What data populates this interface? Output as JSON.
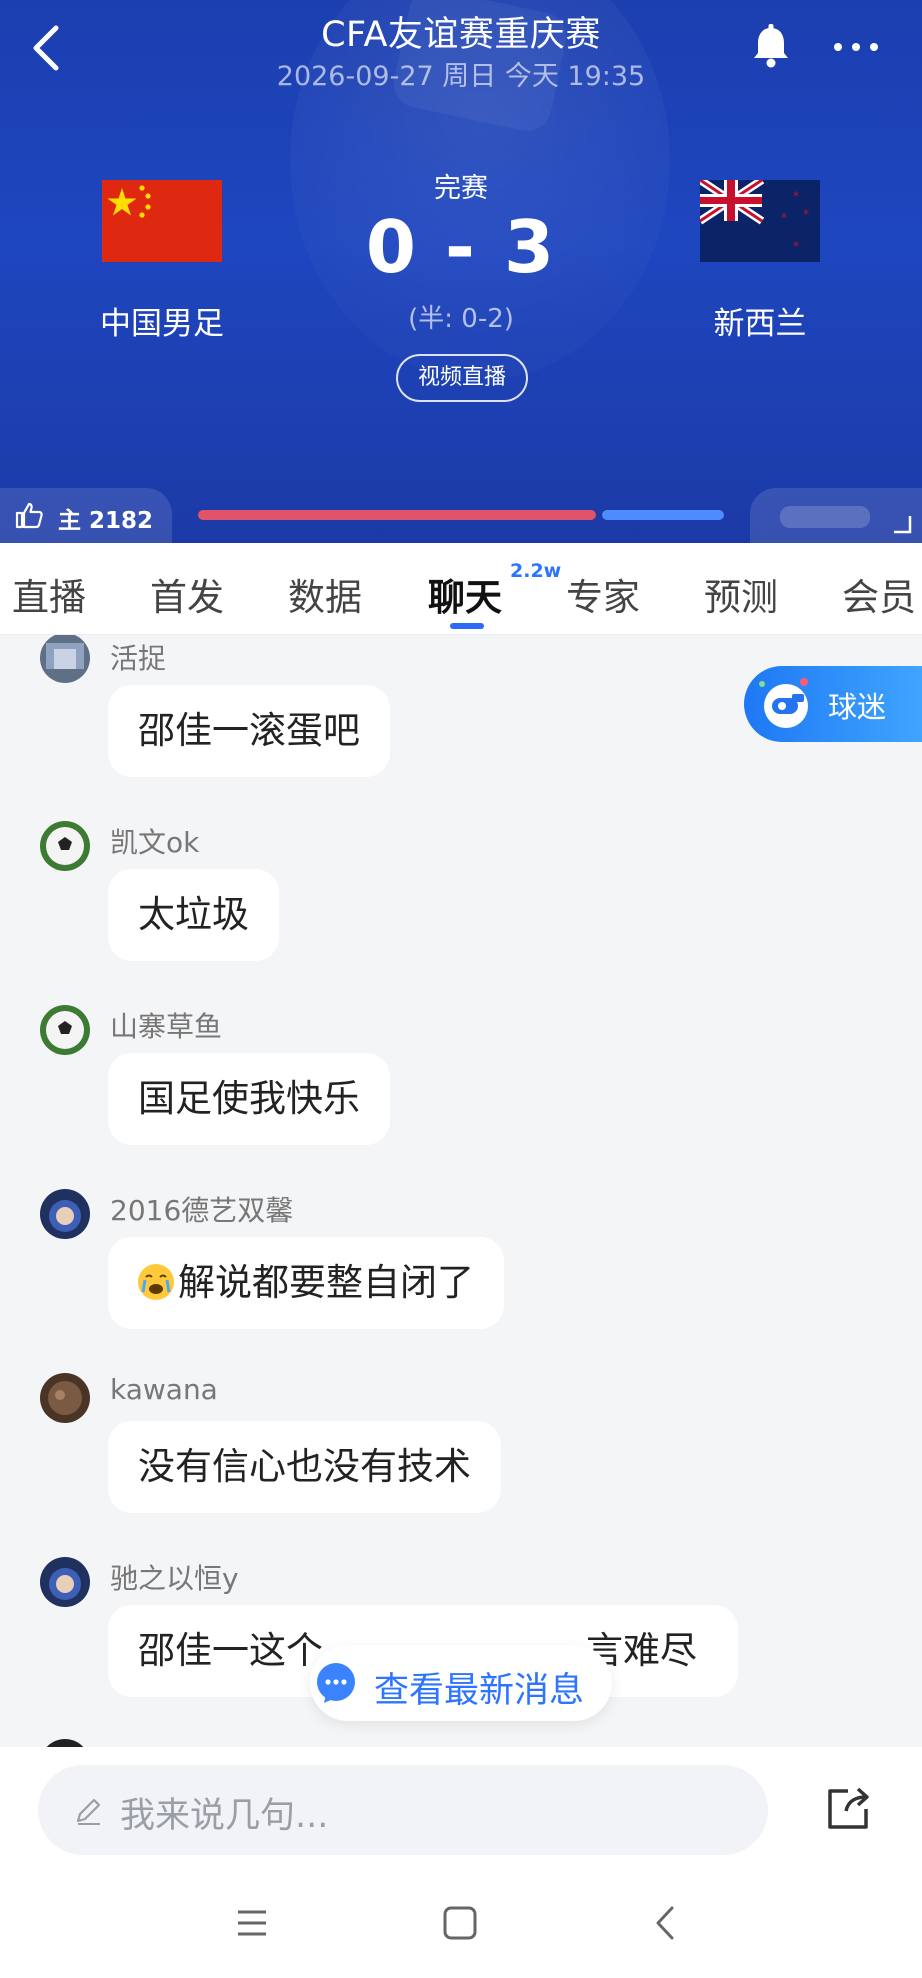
{
  "header": {
    "title": "CFA友谊赛重庆赛",
    "subtitle": "2026-09-27 周日 今天 19:35",
    "status": "完赛",
    "score": "0 - 3",
    "halftime": "(半: 0-2)",
    "video_button": "视频直播",
    "home_team": "中国男足",
    "away_team": "新西兰"
  },
  "support": {
    "home_label": "主 2182"
  },
  "tabs": {
    "items": [
      "直播",
      "首发",
      "数据",
      "聊天",
      "专家",
      "预测",
      "会员"
    ],
    "active": "聊天",
    "chat_badge": "2.2w"
  },
  "chat": {
    "messages": [
      {
        "user": "活捉",
        "text": "邵佳一滚蛋吧"
      },
      {
        "user": "凯文ok",
        "text": "太垃圾"
      },
      {
        "user": "山寨草鱼",
        "text": "国足使我快乐"
      },
      {
        "user": "2016德艺双馨",
        "text": "解说都要整自闭了"
      },
      {
        "user": "kawana",
        "text": "没有信心也没有技术"
      },
      {
        "user": "驰之以恒y",
        "text": "邵佳一这个"
      },
      {
        "user": "",
        "text": "言难尽"
      }
    ],
    "fans_button": "球迷",
    "new_messages_button": "查看最新消息"
  },
  "input": {
    "placeholder": "我来说几句..."
  },
  "colors": {
    "header_blue": "#1e46bf",
    "accent_blue": "#2d74ff",
    "home_bar": "#e25268",
    "away_bar": "#4d8bff"
  },
  "icons": [
    "back-icon",
    "bell-icon",
    "more-icon",
    "thumbs-up-icon",
    "whistle-icon",
    "chat-bubble-icon",
    "pencil-icon",
    "share-icon",
    "menu-icon",
    "home-square-icon",
    "nav-back-icon"
  ]
}
